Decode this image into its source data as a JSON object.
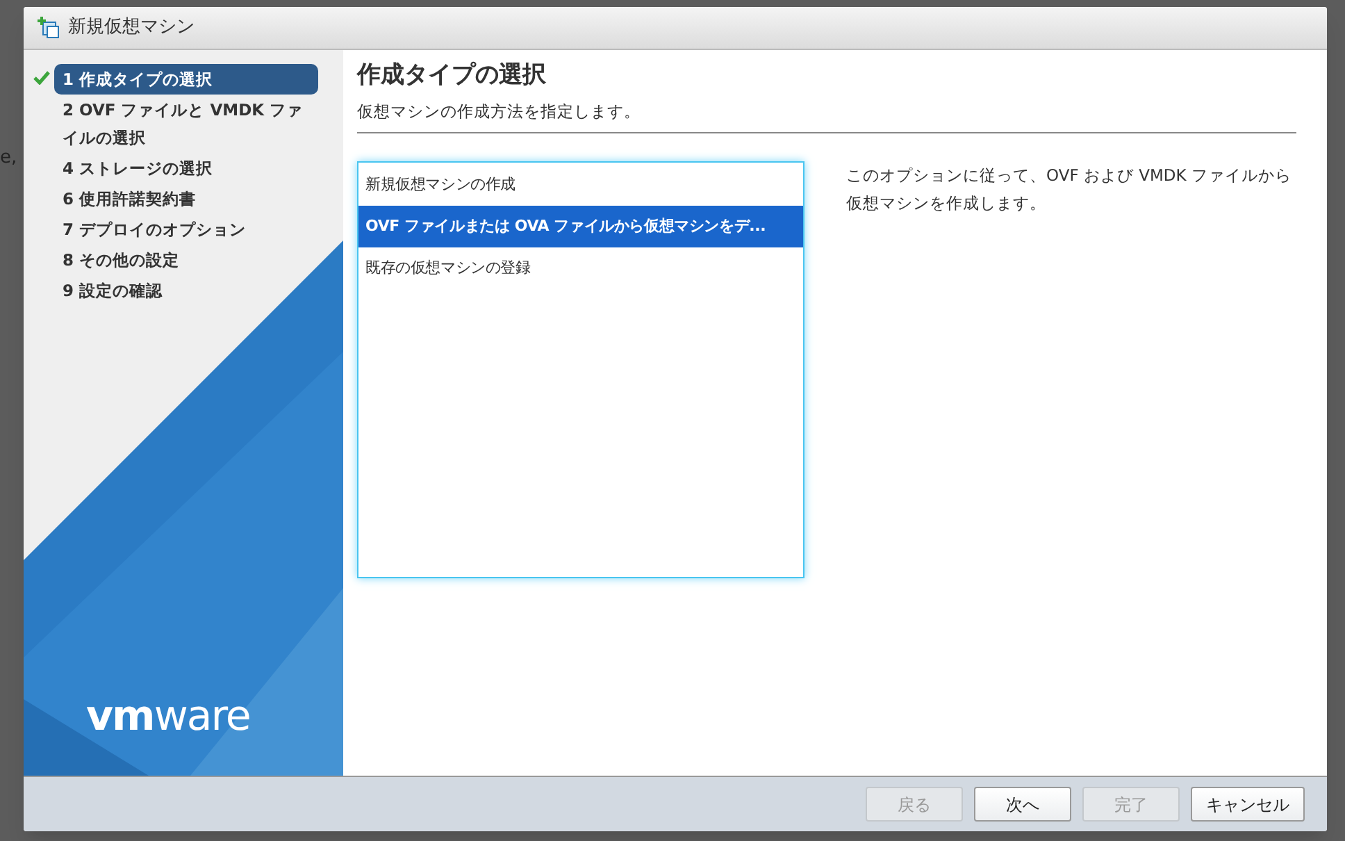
{
  "backdrop_text": "e,",
  "window": {
    "title": "新規仮想マシン"
  },
  "steps": [
    {
      "label": "1 作成タイプの選択",
      "selected": true,
      "done": true
    },
    {
      "label": "2 OVF ファイルと VMDK ファイルの選択",
      "selected": false,
      "done": false
    },
    {
      "label": "4 ストレージの選択",
      "selected": false,
      "done": false
    },
    {
      "label": "6 使用許諾契約書",
      "selected": false,
      "done": false
    },
    {
      "label": "7 デプロイのオプション",
      "selected": false,
      "done": false
    },
    {
      "label": "8 その他の設定",
      "selected": false,
      "done": false
    },
    {
      "label": "9 設定の確認",
      "selected": false,
      "done": false
    }
  ],
  "logo": "**vm**ware",
  "page": {
    "title": "作成タイプの選択",
    "subtitle": "仮想マシンの作成方法を指定します。"
  },
  "options": [
    {
      "label": "新規仮想マシンの作成",
      "selected": false
    },
    {
      "label": "OVF ファイルまたは OVA ファイルから仮想マシンをデ...",
      "selected": true
    },
    {
      "label": "既存の仮想マシンの登録",
      "selected": false
    }
  ],
  "description": "このオプションに従って、OVF および VMDK ファイルから仮想マシンを作成します。",
  "buttons": [
    {
      "label": "戻る",
      "disabled": true
    },
    {
      "label": "次へ",
      "disabled": false
    },
    {
      "label": "完了",
      "disabled": true
    },
    {
      "label": "キャンセル",
      "disabled": false
    }
  ]
}
